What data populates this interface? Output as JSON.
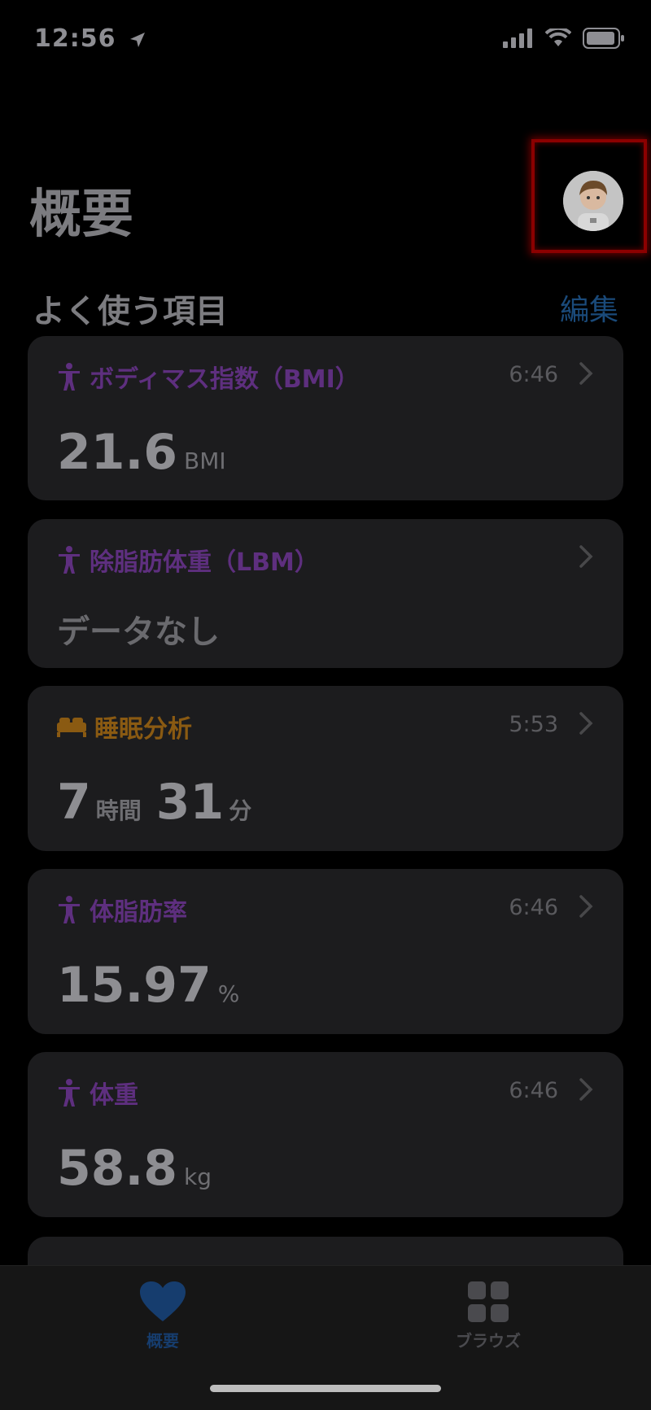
{
  "status_bar": {
    "time": "12:56"
  },
  "header": {
    "title": "概要"
  },
  "favorites": {
    "title": "よく使う項目",
    "edit_label": "編集"
  },
  "cards": [
    {
      "label": "ボディマス指数（BMI）",
      "time": "6:46",
      "value": "21.6",
      "unit": "BMI",
      "icon": "figure-icon",
      "color": "#5e2f7f"
    },
    {
      "label": "除脂肪体重（LBM）",
      "time": "",
      "no_data": "データなし",
      "icon": "figure-icon",
      "color": "#5e2f7f"
    },
    {
      "label": "睡眠分析",
      "time": "5:53",
      "hours": "7",
      "hours_unit": "時間",
      "minutes": "31",
      "minutes_unit": "分",
      "icon": "bed-icon",
      "color": "#8a5a12"
    },
    {
      "label": "体脂肪率",
      "time": "6:46",
      "value": "15.97",
      "unit": "%",
      "icon": "figure-icon",
      "color": "#5e2f7f"
    },
    {
      "label": "体重",
      "time": "6:46",
      "value": "58.8",
      "unit": "kg",
      "icon": "figure-icon",
      "color": "#5e2f7f"
    }
  ],
  "tabbar": {
    "summary_label": "概要",
    "browse_label": "ブラウズ",
    "active_color": "#163d6e",
    "inactive_color": "#4a4a4e"
  }
}
